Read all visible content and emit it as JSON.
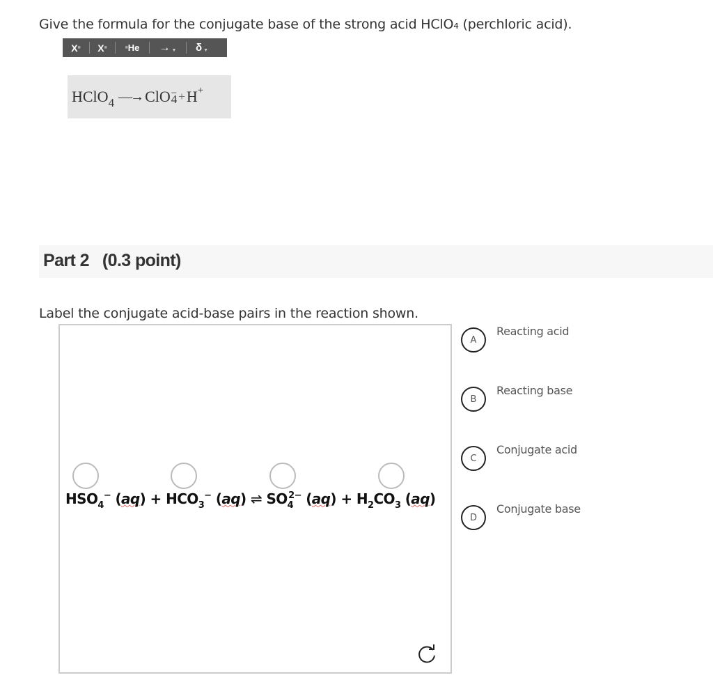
{
  "part1": {
    "question": "Give the formula for the conjugate base of the strong acid HClO₄ (perchloric acid).",
    "toolbar": [
      {
        "icon": "superscript-icon",
        "label": "X"
      },
      {
        "icon": "subscript-icon",
        "label": "X"
      },
      {
        "icon": "element-icon",
        "label": "He"
      },
      {
        "icon": "arrow-icon",
        "label": "→"
      },
      {
        "icon": "delta-icon",
        "label": "δ"
      }
    ],
    "answer": {
      "reactant": "HClO",
      "reactant_sub": "4",
      "arrow": "—→",
      "product1": "ClO",
      "product1_sub": "4",
      "product1_sup": "−",
      "plus": "+",
      "product2": "H",
      "product2_sup": "+"
    }
  },
  "part2": {
    "title": "Part 2   (0.3 point)",
    "question": "Label the conjugate acid-base pairs in the reaction shown.",
    "equation": {
      "t1": "HSO",
      "t1_sub": "4",
      "t1_sup": "−",
      "aq": "aq",
      "plus": "+",
      "t2": "HCO",
      "t2_sub": "3",
      "t2_sup": "−",
      "eq_arrow": "⇌",
      "t3": "SO",
      "t3_sub": "4",
      "t3_sup": "2−",
      "t4a": "H",
      "t4_sub1": "2",
      "t4b": "CO",
      "t4_sub2": "3"
    },
    "labels": [
      {
        "letter": "A",
        "text": "Reacting acid"
      },
      {
        "letter": "B",
        "text": "Reacting base"
      },
      {
        "letter": "C",
        "text": "Conjugate acid"
      },
      {
        "letter": "D",
        "text": "Conjugate base"
      }
    ],
    "reset_icon": "reset-icon"
  }
}
